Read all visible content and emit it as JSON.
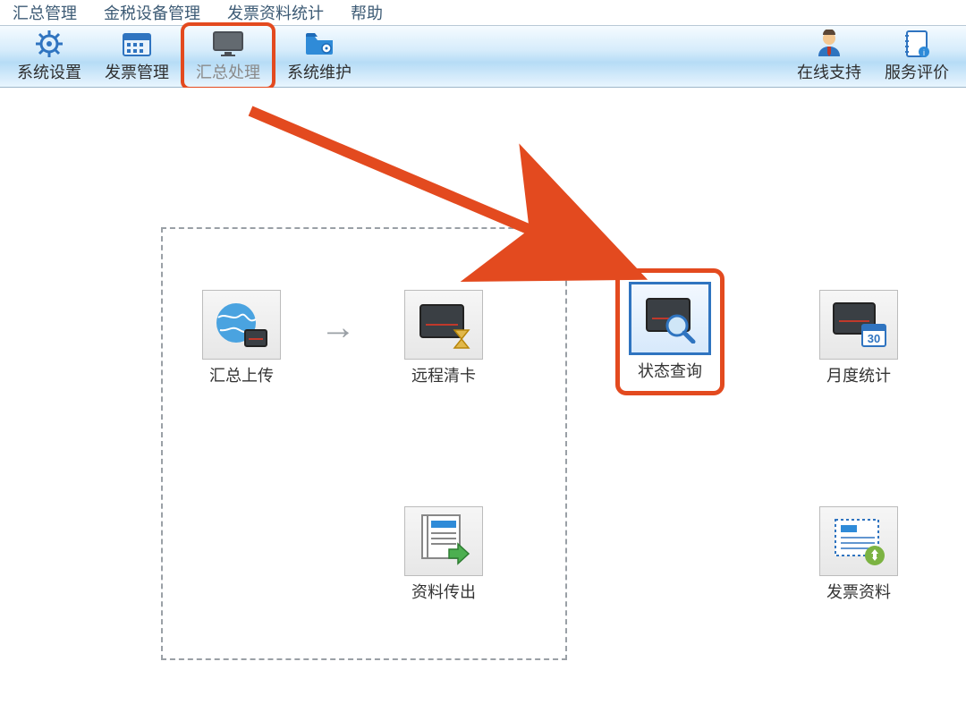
{
  "menu": {
    "items": [
      "汇总管理",
      "金税设备管理",
      "发票资料统计",
      "帮助"
    ]
  },
  "toolbar": {
    "system_settings": "系统设置",
    "invoice_mgmt": "发票管理",
    "summary_process": "汇总处理",
    "system_maint": "系统维护",
    "online_support": "在线支持",
    "service_rating": "服务评价"
  },
  "cards": {
    "upload": "汇总上传",
    "clear": "远程清卡",
    "status": "状态查询",
    "monthly": "月度统计",
    "export": "资料传出",
    "invoice": "发票资料"
  },
  "flow_arrow": "→"
}
